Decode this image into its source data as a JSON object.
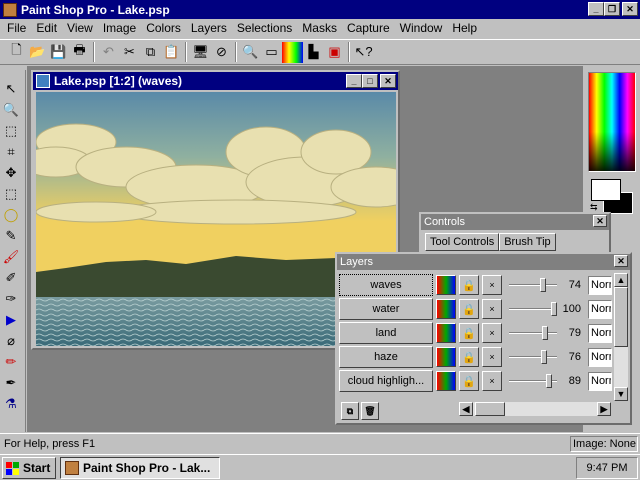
{
  "app": {
    "title": "Paint Shop Pro - Lake.psp"
  },
  "menu": [
    "File",
    "Edit",
    "View",
    "Image",
    "Colors",
    "Layers",
    "Selections",
    "Masks",
    "Capture",
    "Window",
    "Help"
  ],
  "image_window": {
    "title": "Lake.psp [1:2] (waves)"
  },
  "controls": {
    "title": "Controls",
    "tabs": [
      "Tool Controls",
      "Brush Tip"
    ]
  },
  "layers": {
    "title": "Layers",
    "rows": [
      {
        "name": "waves",
        "opacity": "74",
        "mode": "Normal",
        "level": 0.74
      },
      {
        "name": "water",
        "opacity": "100",
        "mode": "Normal",
        "level": 1.0
      },
      {
        "name": "land",
        "opacity": "79",
        "mode": "Normal",
        "level": 0.79
      },
      {
        "name": "haze",
        "opacity": "76",
        "mode": "Normal",
        "level": 0.76
      },
      {
        "name": "cloud highligh...",
        "opacity": "89",
        "mode": "Normal",
        "level": 0.89
      }
    ]
  },
  "status": {
    "help": "For Help, press F1",
    "image": "Image: None"
  },
  "taskbar": {
    "start": "Start",
    "task": "Paint Shop Pro - Lak...",
    "clock": "9:47 PM"
  },
  "colors": {
    "titlebar": "#000080",
    "desktop": "#808080",
    "face": "#c0c0c0"
  }
}
